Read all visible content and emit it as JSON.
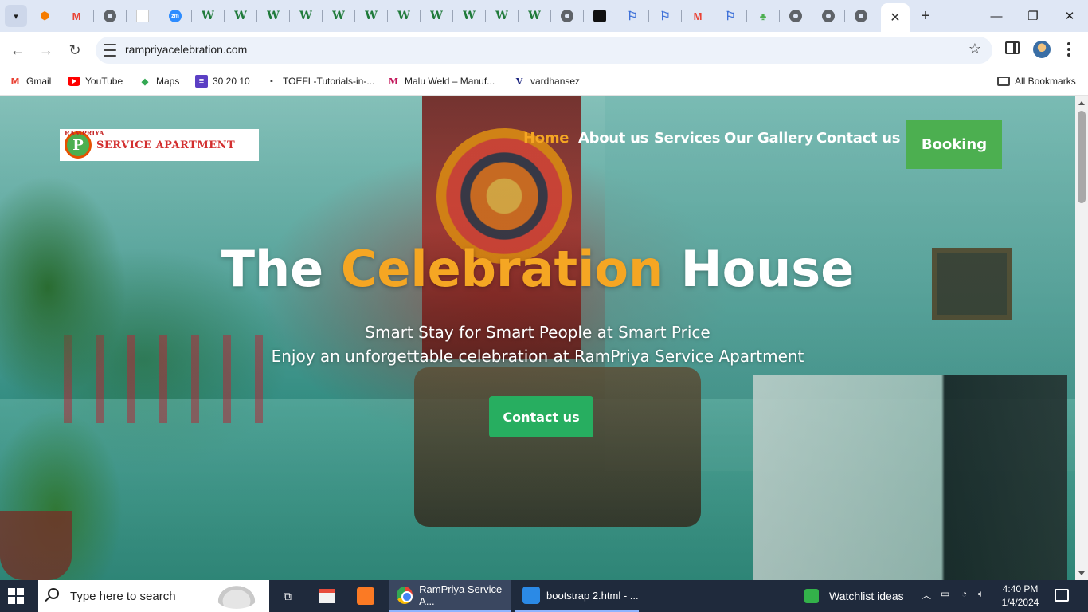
{
  "browser": {
    "url": "rampriyacelebration.com",
    "bookmarks": [
      {
        "label": "Gmail",
        "icon": "gmail-icon"
      },
      {
        "label": "YouTube",
        "icon": "youtube-icon"
      },
      {
        "label": "Maps",
        "icon": "maps-icon"
      },
      {
        "label": "30 20 10",
        "icon": "list-icon"
      },
      {
        "label": "TOEFL-Tutorials-in-...",
        "icon": "dot-icon"
      },
      {
        "label": "Malu Weld – Manuf...",
        "icon": "malu-icon"
      },
      {
        "label": "vardhansez",
        "icon": "v-icon"
      }
    ],
    "all_bookmarks": "All Bookmarks"
  },
  "site": {
    "logo_text": "SERVICE APARTMENT",
    "logo_arc": "RAMPRIYA",
    "logo_letter": "P",
    "nav": [
      "Home",
      "About us",
      "Services",
      "Our Gallery",
      "Contact us"
    ],
    "booking": "Booking",
    "hero": {
      "title_part1": "The ",
      "title_accent": "Celebration",
      "title_part2": " House",
      "subtitle1": "Smart Stay for Smart People at Smart Price",
      "subtitle2": "Enjoy an unforgettable celebration at RamPriya Service Apartment",
      "cta": "Contact us"
    },
    "colors": {
      "accent": "#f5a623",
      "booking_green": "#4caf50",
      "cta_green": "#27ae60"
    }
  },
  "taskbar": {
    "search_placeholder": "Type here to search",
    "apps": [
      {
        "label": "RamPriya Service A...",
        "icon": "chrome-icon"
      },
      {
        "label": "bootstrap 2.html - ...",
        "icon": "vscode-icon"
      }
    ],
    "watchlist": "Watchlist ideas",
    "time": "4:40 PM",
    "date": "1/4/2024"
  }
}
